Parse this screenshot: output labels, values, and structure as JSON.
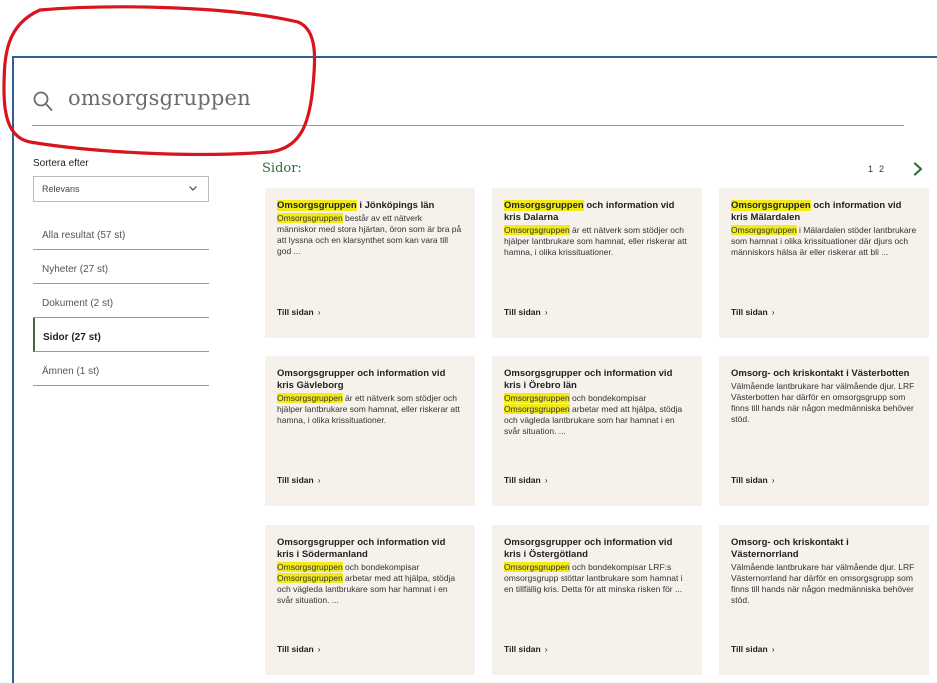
{
  "search": {
    "query": "omsorgsgruppen"
  },
  "sort": {
    "label": "Sortera efter",
    "selected": "Relevans"
  },
  "filters": [
    {
      "label": "Alla resultat (57 st)",
      "active": false
    },
    {
      "label": "Nyheter (27 st)",
      "active": false
    },
    {
      "label": "Dokument (2 st)",
      "active": false
    },
    {
      "label": "Sidor (27 st)",
      "active": true
    },
    {
      "label": "Ämnen (1 st)",
      "active": false
    }
  ],
  "section": {
    "title": "Sidor:"
  },
  "pagination": {
    "pages": [
      "1",
      "2"
    ]
  },
  "colors": {
    "highlight": "#f2ea1b",
    "card_bg": "#f6f1ea",
    "accent_green": "#2f6e37",
    "annotation_red": "#d8141c"
  },
  "cards": [
    {
      "title_hl": "Omsorgsgruppen",
      "title_rest": " i Jönköpings län",
      "desc_hl": "Omsorgsgruppen",
      "desc_rest": " består av ett nätverk människor med stora hjärtan, öron som är bra på att lyssna och en klarsynthet som kan vara till god ...",
      "link": "Till sidan"
    },
    {
      "title_hl": "Omsorgsgruppen",
      "title_rest": " och information vid kris Dalarna",
      "desc_hl": "Omsorgsgruppen",
      "desc_rest": " är ett nätverk som stödjer och hjälper lantbrukare som hamnat, eller riskerar att hamna, i olika krissituationer.",
      "link": "Till sidan"
    },
    {
      "title_hl": "Omsorgsgruppen",
      "title_rest": " och information vid kris Mälardalen",
      "desc_hl": "Omsorgsgruppen",
      "desc_rest": " i Mälardalen stöder lantbrukare som hamnat i olika krissituationer där djurs och människors hälsa är eller riskerar att bli ...",
      "link": "Till sidan"
    },
    {
      "title_hl": "",
      "title_rest": "Omsorgsgrupper och information vid kris Gävleborg",
      "desc_hl": "Omsorgsgruppen",
      "desc_rest": " är ett nätverk som stödjer och hjälper lantbrukare som hamnat, eller riskerar att hamna, i olika krissituationer.",
      "link": "Till sidan"
    },
    {
      "title_hl": "",
      "title_rest": "Omsorgsgrupper och information vid kris i Örebro län",
      "desc_hl": "Omsorgsgruppen",
      "desc_rest": " och bondekompisar",
      "desc_hl2": "Omsorgsgruppen",
      "desc_rest2": " arbetar med att hjälpa, stödja och vägleda lantbrukare som har hamnat i en svår situation. ...",
      "link": "Till sidan"
    },
    {
      "title_hl": "",
      "title_rest": "Omsorg- och kriskontakt i Västerbotten",
      "desc_hl": "",
      "desc_rest": "Välmående lantbrukare har välmående djur. LRF Västerbotten har därför en omsorgsgrupp som finns till hands när någon medmänniska behöver stöd.",
      "link": "Till sidan"
    },
    {
      "title_hl": "",
      "title_rest": "Omsorgsgrupper och information vid kris i Södermanland",
      "desc_hl": "Omsorgsgruppen",
      "desc_rest": " och bondekompisar",
      "desc_hl2": "Omsorgsgruppen",
      "desc_rest2": " arbetar med att hjälpa, stödja och vägleda lantbrukare som har hamnat i en svår situation. ...",
      "link": "Till sidan"
    },
    {
      "title_hl": "",
      "title_rest": "Omsorgsgrupper och information vid kris i Östergötland",
      "desc_hl": "Omsorgsgruppen",
      "desc_rest": " och bondekompisar LRF:s omsorgsgrupp stöttar lantbrukare som hamnat i en tillfällig kris. Detta för att minska risken för ...",
      "link": "Till sidan"
    },
    {
      "title_hl": "",
      "title_rest": "Omsorg- och kriskontakt i Västernorrland",
      "desc_hl": "",
      "desc_rest": "Välmående lantbrukare har välmående djur. LRF Västernorrland har därför en omsorgsgrupp som finns till hands när någon medmänniska behöver stöd.",
      "link": "Till sidan"
    }
  ]
}
